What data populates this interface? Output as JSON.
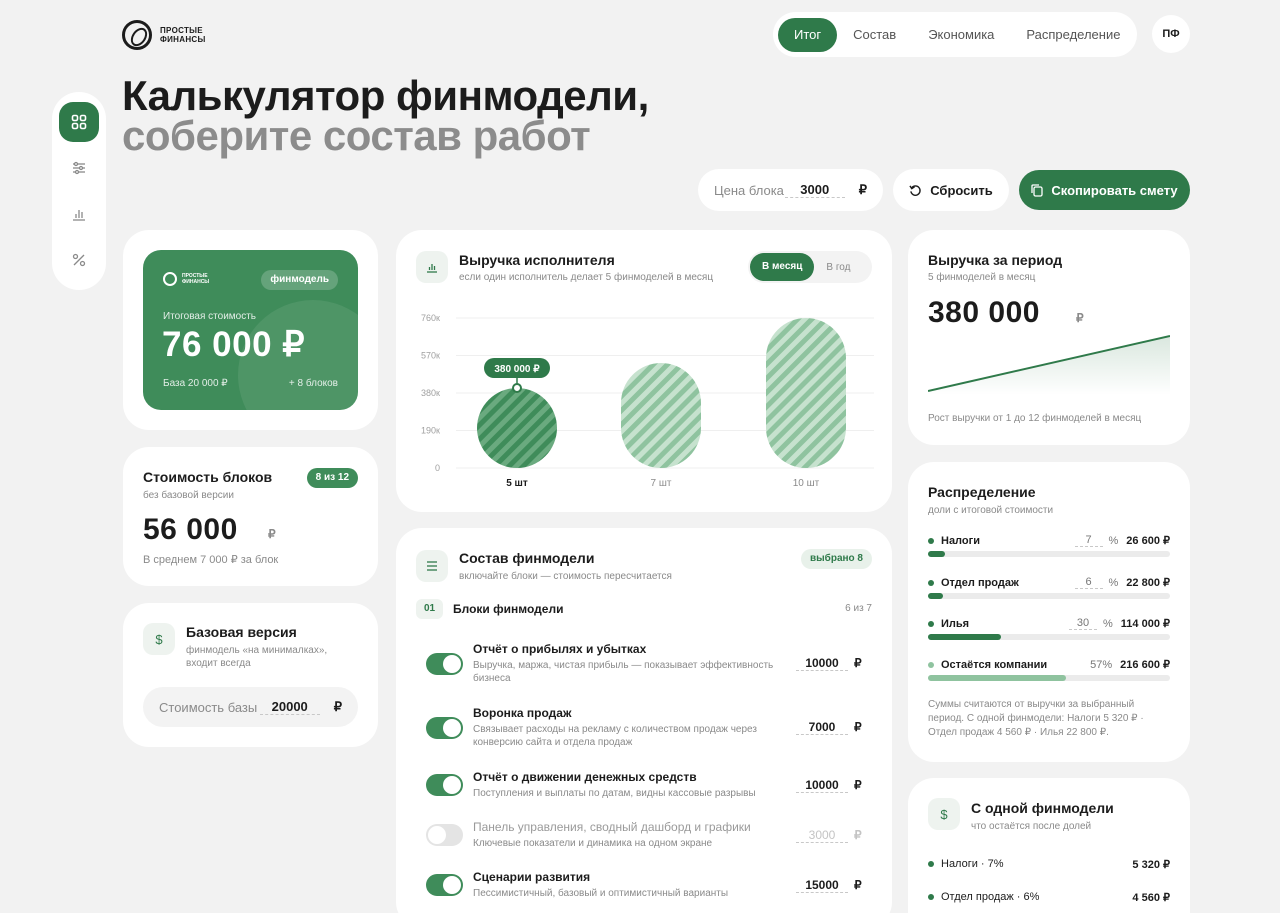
{
  "brand": {
    "line1": "ПРОСТЫЕ",
    "line2": "ФИНАНСЫ"
  },
  "nav": {
    "tabs": [
      "Итог",
      "Состав",
      "Экономика",
      "Распределение"
    ],
    "active": 0,
    "avatar": "ПФ"
  },
  "hero": {
    "line1": "Калькулятор финмодели,",
    "line2": "соберите состав работ"
  },
  "sidebar": {
    "icons": [
      "grid-icon",
      "sliders-icon",
      "bar-chart-icon",
      "percent-icon"
    ],
    "active": 0
  },
  "controls": {
    "price_label": "Цена блока",
    "price_value": "3000",
    "currency": "₽",
    "reset_label": "Сбросить",
    "copy_label": "Скопировать смету"
  },
  "total_card": {
    "brand1": "ПРОСТЫЕ",
    "brand2": "ФИНАНСЫ",
    "badge": "финмодель",
    "label": "Итоговая стоимость",
    "value": "76 000 ₽",
    "base": "База 20 000 ₽",
    "extra": "+ 8 блоков"
  },
  "blocks_cost": {
    "title": "Стоимость блоков",
    "subtitle": "без базовой версии",
    "badge": "8 из 12",
    "value": "56 000",
    "currency": "₽",
    "avg": "В среднем 7 000 ₽ за блок"
  },
  "base_version": {
    "title": "Базовая версия",
    "desc": "финмодель «на минималках», входит всегда",
    "field_label": "Стоимость базы",
    "field_value": "20000",
    "currency": "₽"
  },
  "revenue_chart": {
    "title": "Выручка исполнителя",
    "subtitle": "если один исполнитель делает 5 финмоделей в месяц",
    "toggle": [
      "В месяц",
      "В год"
    ],
    "toggle_active": 0,
    "tooltip": "380 000 ₽"
  },
  "chart_data": {
    "type": "bar",
    "categories": [
      "5 шт",
      "7 шт",
      "10 шт"
    ],
    "values": [
      380000,
      532000,
      760000
    ],
    "yticks": [
      "760к",
      "570к",
      "380к",
      "190к",
      "0"
    ],
    "ylim": [
      0,
      760000
    ],
    "highlight": 0,
    "grid": true
  },
  "composition": {
    "title": "Состав финмодели",
    "subtitle": "включайте блоки — стоимость пересчитается",
    "badge": "выбрано 8",
    "section_num": "01",
    "section_title": "Блоки финмодели",
    "section_count": "6 из 7",
    "items": [
      {
        "title": "Отчёт о прибылях и убытках",
        "desc": "Выручка, маржа, чистая прибыль — показывает эффективность бизнеса",
        "value": "10000",
        "on": true
      },
      {
        "title": "Воронка продаж",
        "desc": "Связывает расходы на рекламу с количеством продаж через конверсию сайта и отдела продаж",
        "value": "7000",
        "on": true
      },
      {
        "title": "Отчёт о движении денежных средств",
        "desc": "Поступления и выплаты по датам, видны кассовые разрывы",
        "value": "10000",
        "on": true
      },
      {
        "title": "Панель управления, сводный дашборд и графики",
        "desc": "Ключевые показатели и динамика на одном экране",
        "value": "3000",
        "on": false
      },
      {
        "title": "Сценарии развития",
        "desc": "Пессимистичный, базовый и оптимистичный варианты",
        "value": "15000",
        "on": true
      }
    ],
    "currency": "₽"
  },
  "period_revenue": {
    "title": "Выручка за период",
    "subtitle": "5 финмоделей в месяц",
    "value": "380 000",
    "currency": "₽",
    "caption": "Рост выручки от 1 до 12 финмоделей в месяц"
  },
  "distribution": {
    "title": "Распределение",
    "subtitle": "доли с итоговой стоимости",
    "rows": [
      {
        "label": "Налоги",
        "pct": "7",
        "amount": "26 600 ₽",
        "share": 0.07,
        "editable": true
      },
      {
        "label": "Отдел продаж",
        "pct": "6",
        "amount": "22 800 ₽",
        "share": 0.06,
        "editable": true
      },
      {
        "label": "Илья",
        "pct": "30",
        "amount": "114 000 ₽",
        "share": 0.3,
        "editable": true
      },
      {
        "label": "Остаётся компании",
        "pct": "57%",
        "amount": "216 600 ₽",
        "share": 0.57,
        "editable": false
      }
    ],
    "pct_sign": "%",
    "note": "Суммы считаются от выручки за выбранный период. С одной финмодели: Налоги 5 320 ₽ · Отдел продаж 4 560 ₽ · Илья 22 800 ₽.",
    "colors": {
      "main": "#2f7a4a",
      "remain": "#8fc39f"
    }
  },
  "per_model": {
    "title": "С одной финмодели",
    "subtitle": "что остаётся после долей",
    "rows": [
      {
        "label": "Налоги · 7%",
        "amount": "5 320 ₽"
      },
      {
        "label": "Отдел продаж · 6%",
        "amount": "4 560 ₽"
      }
    ]
  }
}
